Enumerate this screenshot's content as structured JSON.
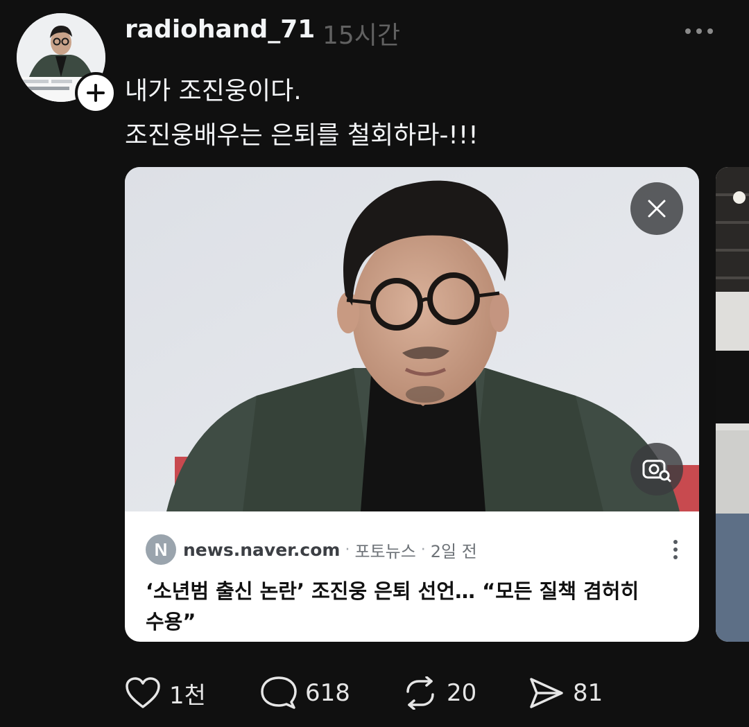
{
  "post": {
    "username": "radiohand_71",
    "time": "15시간",
    "lines": [
      "내가 조진웅이다.",
      "조진웅배우는 은퇴를 철회하라-!!!"
    ]
  },
  "link_card": {
    "source_initial": "N",
    "domain": "news.naver.com",
    "category": "포토뉴스",
    "age": "2일 전",
    "separator": "·",
    "headline_lines": [
      "‘소년범 출신 논란’ 조진웅 은퇴 선언… “모든 질책 겸허히",
      "수용”"
    ]
  },
  "actions": {
    "likes": "1천",
    "replies": "618",
    "reposts": "20",
    "shares": "81"
  },
  "icons": {
    "more": "more-horizontal-icon",
    "follow": "plus-icon",
    "close": "close-icon",
    "lens": "visual-search-icon",
    "like": "heart-icon",
    "reply": "comment-icon",
    "repost": "repost-icon",
    "share": "send-icon"
  },
  "colors": {
    "background": "#101010",
    "text_primary": "#f3f5f7",
    "text_secondary": "#616161",
    "card_background": "#ffffff"
  }
}
